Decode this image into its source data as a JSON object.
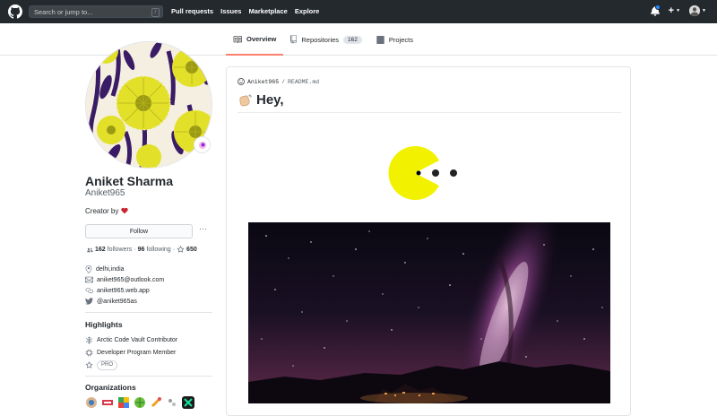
{
  "header": {
    "search_placeholder": "Search or jump to...",
    "search_shortcut": "/",
    "nav": [
      "Pull requests",
      "Issues",
      "Marketplace",
      "Explore"
    ],
    "plus_label": "+"
  },
  "tabs": [
    {
      "label": "Overview",
      "active": true
    },
    {
      "label": "Repositories",
      "count": "162"
    },
    {
      "label": "Projects"
    }
  ],
  "profile": {
    "name": "Aniket Sharma",
    "login": "Aniket965",
    "bio": "Creator by",
    "follow_label": "Follow",
    "more_label": "···",
    "followers_count": "162",
    "followers_label": "followers",
    "separator": "·",
    "following_count": "96",
    "following_label": "following",
    "stars_count": "650",
    "vcard": {
      "location": "delhi,india",
      "email": "aniket965@outlook.com",
      "website": "aniket965.web.app",
      "twitter": "@aniket965as"
    }
  },
  "highlights": {
    "title": "Highlights",
    "items": [
      "Arctic Code Vault Contributor",
      "Developer Program Member"
    ],
    "pro_badge": "PRO"
  },
  "organizations": {
    "title": "Organizations"
  },
  "readme": {
    "owner": "Aniket965",
    "slash": "/",
    "file": "README.md",
    "heading": "Hey,"
  },
  "colors": {
    "header_bg": "#24292e",
    "active_tab": "#f9826c",
    "heart": "#cb2431",
    "pacman": "#f2f200"
  }
}
